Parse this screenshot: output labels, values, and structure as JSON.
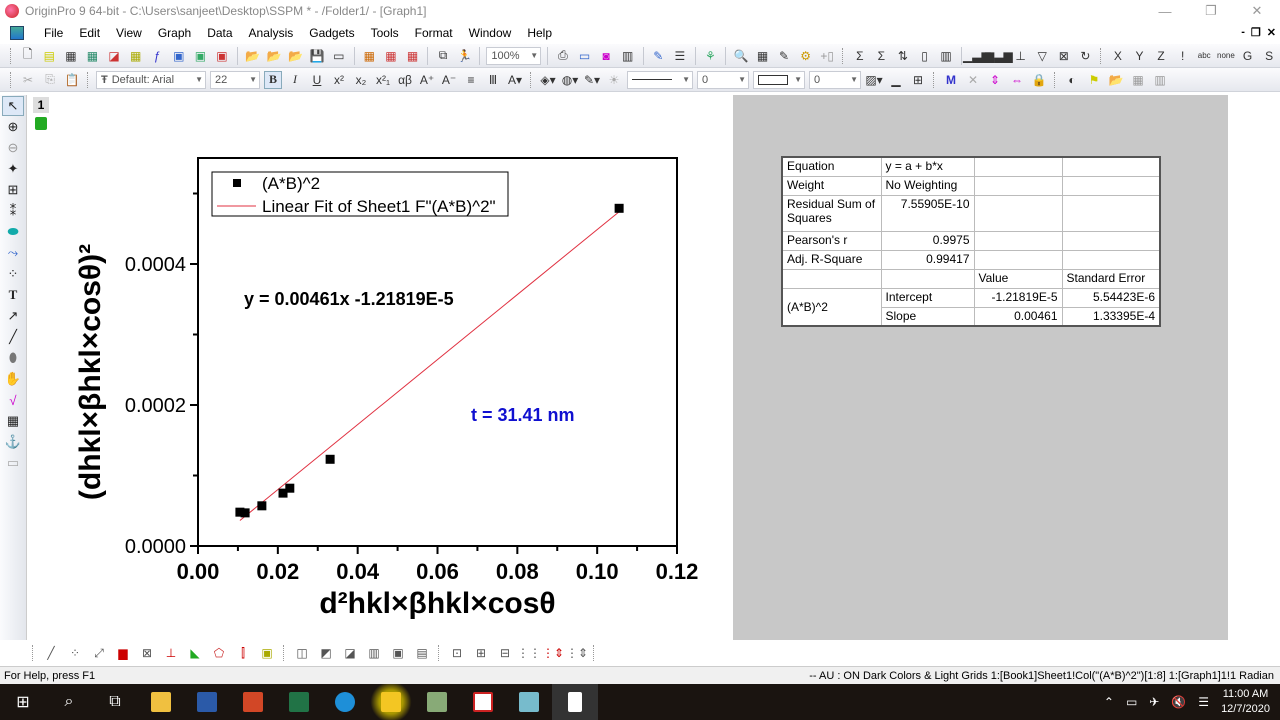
{
  "window": {
    "title": "OriginPro 9 64-bit - C:\\Users\\sanjeet\\Desktop\\SSPM * - /Folder1/ - [Graph1]",
    "controls": [
      "minimize",
      "restore",
      "close"
    ]
  },
  "menubar": {
    "items": [
      "File",
      "Edit",
      "View",
      "Graph",
      "Data",
      "Analysis",
      "Gadgets",
      "Tools",
      "Format",
      "Window",
      "Help"
    ],
    "mdi_controls": [
      "-",
      "❐",
      "✕"
    ]
  },
  "toolbar1": {
    "zoom_value": "100%",
    "right_labels": [
      "X",
      "Y",
      "Z",
      "G",
      "S"
    ]
  },
  "toolbar2": {
    "font_value": "Default: Arial",
    "font_size_value": "22",
    "format_buttons": [
      "B",
      "I",
      "U",
      "x²",
      "x₂",
      "x²₁",
      "αβ",
      "A⁺",
      "A⁻"
    ],
    "line_width_value": "0",
    "border_width_value": "0"
  },
  "layer": {
    "number": "1"
  },
  "graph": {
    "equation_label": "y = 0.00461x -1.21819E-5",
    "annotation": "t = 31.41 nm",
    "annotation_color": "#1010d0",
    "fit_line_color": "#e03040"
  },
  "chart_data": {
    "type": "scatter",
    "title": "",
    "xlabel": "d²hkl×βhkl×cosθ",
    "ylabel": "(dhkl×βhkl×cosθ)²",
    "xlim": [
      0.0,
      0.12
    ],
    "ylim": [
      0.0,
      0.00054
    ],
    "x_ticks": [
      "0.00",
      "0.02",
      "0.04",
      "0.06",
      "0.08",
      "0.10",
      "0.12"
    ],
    "y_ticks": [
      "0.0000",
      "0.0002",
      "0.0004"
    ],
    "x_tick_values": [
      0.0,
      0.02,
      0.04,
      0.06,
      0.08,
      0.1,
      0.12
    ],
    "y_tick_values": [
      0.0,
      0.0002,
      0.0004
    ],
    "grid": false,
    "legend": {
      "placement": "top-left",
      "entries": [
        "(A*B)^2",
        "Linear Fit of Sheet1 F\"(A*B)^2\""
      ]
    },
    "series": [
      {
        "name": "(A*B)^2",
        "kind": "scatter",
        "marker": "square",
        "color": "#000000",
        "x": [
          0.0105,
          0.0118,
          0.016,
          0.0213,
          0.023,
          0.0331,
          0.1055
        ],
        "y": [
          4.8e-05,
          4.7e-05,
          5.7e-05,
          7.5e-05,
          8.2e-05,
          0.000123,
          0.000479
        ]
      },
      {
        "name": "Linear Fit of Sheet1 F\"(A*B)^2\"",
        "kind": "line",
        "color": "#e03040",
        "slope": 0.00461,
        "intercept": -1.21819e-05,
        "x_range": [
          0.0105,
          0.1055
        ]
      }
    ]
  },
  "fit_table": {
    "rows": [
      {
        "label": "Equation",
        "value": "y = a + b*x"
      },
      {
        "label": "Weight",
        "value": "No Weighting"
      },
      {
        "label": "Residual Sum of Squares",
        "value": "7.55905E-10"
      },
      {
        "label": "Pearson's r",
        "value": "0.9975"
      },
      {
        "label": "Adj. R-Square",
        "value": "0.99417"
      }
    ],
    "param_headers": [
      "Value",
      "Standard Error"
    ],
    "group_label": "(A*B)^2",
    "params": [
      {
        "name": "Intercept",
        "value": "-1.21819E-5",
        "error": "5.54423E-6"
      },
      {
        "name": "Slope",
        "value": "0.00461",
        "error": "1.33395E-4"
      }
    ]
  },
  "statusbar": {
    "help_text": "For Help, press F1",
    "info_text": "-- AU : ON  Dark Colors & Light Grids  1:[Book1]Sheet1!Col(\"(A*B)^2\")[1:8]  1:[Graph1]1!1  Radian"
  },
  "taskbar": {
    "time": "11:00 AM",
    "date": "12/7/2020",
    "apps": [
      "start",
      "search",
      "task-view",
      "file-explorer",
      "word",
      "powerpoint",
      "excel",
      "edge",
      "folder",
      "pps-toolbar",
      "origin",
      "notepad-app",
      "blank-doc"
    ]
  }
}
